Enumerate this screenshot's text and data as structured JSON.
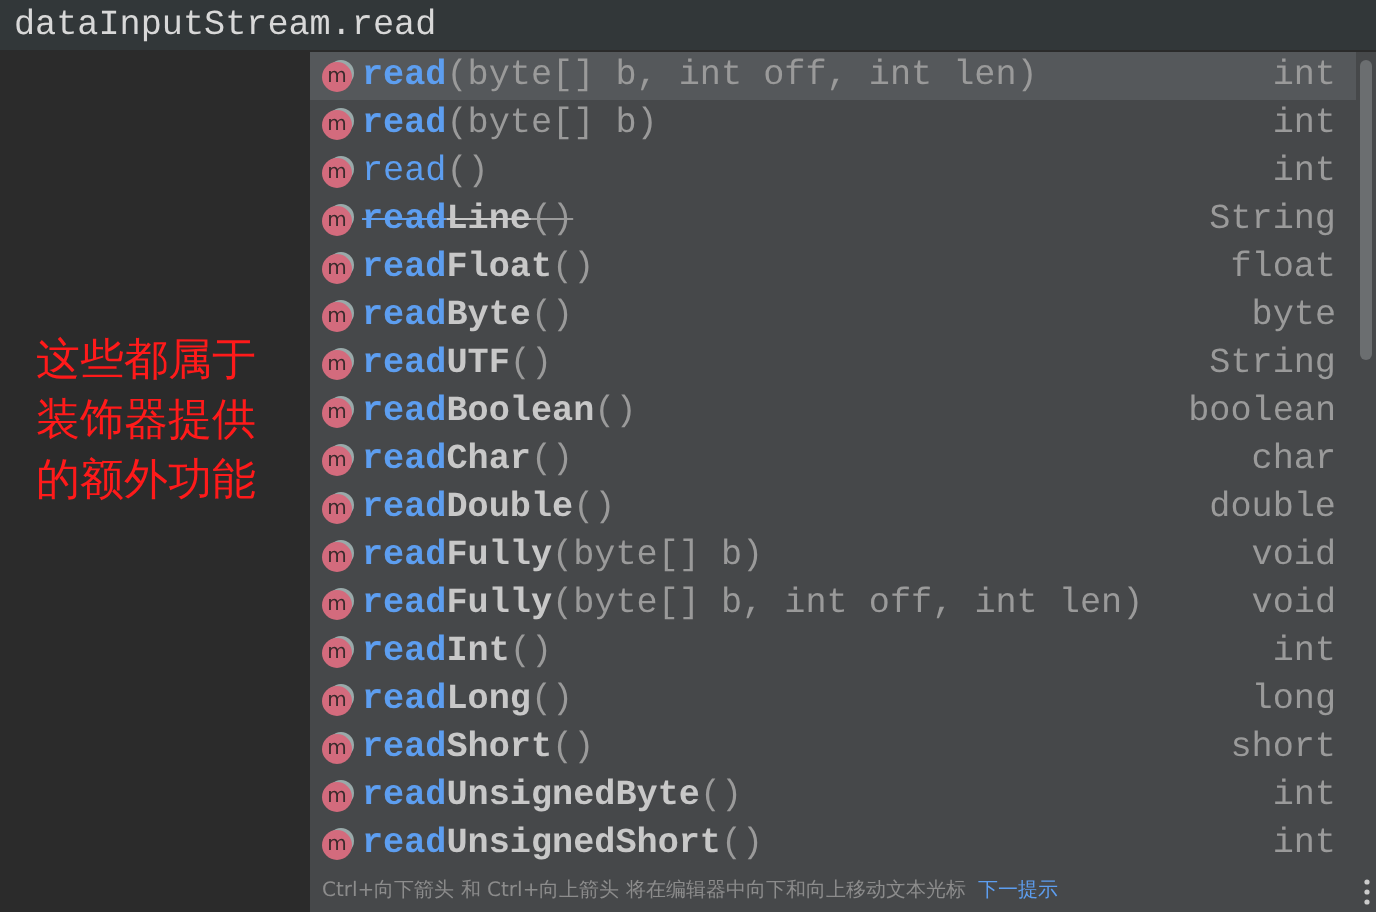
{
  "editor": {
    "code_line": "dataInputStream.read"
  },
  "annotation": {
    "lines": [
      "这些都属于",
      "装饰器提供",
      "的额外功能"
    ]
  },
  "completion_popup": {
    "items": [
      {
        "icon": "m",
        "match": "read",
        "params": "(byte[] b, int off, int len)",
        "type": "int",
        "selected": true,
        "bold": true,
        "deprecated": false
      },
      {
        "icon": "m",
        "match": "read",
        "params": "(byte[] b)",
        "type": "int",
        "selected": false,
        "bold": true,
        "deprecated": false
      },
      {
        "icon": "m",
        "match": "read",
        "params": "()",
        "type": "int",
        "selected": false,
        "bold": false,
        "deprecated": false
      },
      {
        "icon": "m",
        "match": "read",
        "rest": "Line",
        "params": "()",
        "type": "String",
        "selected": false,
        "bold": true,
        "deprecated": true
      },
      {
        "icon": "m",
        "match": "read",
        "rest": "Float",
        "params": "()",
        "type": "float",
        "selected": false,
        "bold": true,
        "deprecated": false
      },
      {
        "icon": "m",
        "match": "read",
        "rest": "Byte",
        "params": "()",
        "type": "byte",
        "selected": false,
        "bold": true,
        "deprecated": false
      },
      {
        "icon": "m",
        "match": "read",
        "rest": "UTF",
        "params": "()",
        "type": "String",
        "selected": false,
        "bold": true,
        "deprecated": false
      },
      {
        "icon": "m",
        "match": "read",
        "rest": "Boolean",
        "params": "()",
        "type": "boolean",
        "selected": false,
        "bold": true,
        "deprecated": false
      },
      {
        "icon": "m",
        "match": "read",
        "rest": "Char",
        "params": "()",
        "type": "char",
        "selected": false,
        "bold": true,
        "deprecated": false
      },
      {
        "icon": "m",
        "match": "read",
        "rest": "Double",
        "params": "()",
        "type": "double",
        "selected": false,
        "bold": true,
        "deprecated": false
      },
      {
        "icon": "m",
        "match": "read",
        "rest": "Fully",
        "params": "(byte[] b)",
        "type": "void",
        "selected": false,
        "bold": true,
        "deprecated": false
      },
      {
        "icon": "m",
        "match": "read",
        "rest": "Fully",
        "params": "(byte[] b, int off, int len)",
        "type": "void",
        "selected": false,
        "bold": true,
        "deprecated": false
      },
      {
        "icon": "m",
        "match": "read",
        "rest": "Int",
        "params": "()",
        "type": "int",
        "selected": false,
        "bold": true,
        "deprecated": false
      },
      {
        "icon": "m",
        "match": "read",
        "rest": "Long",
        "params": "()",
        "type": "long",
        "selected": false,
        "bold": true,
        "deprecated": false
      },
      {
        "icon": "m",
        "match": "read",
        "rest": "Short",
        "params": "()",
        "type": "short",
        "selected": false,
        "bold": true,
        "deprecated": false
      },
      {
        "icon": "m",
        "match": "read",
        "rest": "UnsignedByte",
        "params": "()",
        "type": "int",
        "selected": false,
        "bold": true,
        "deprecated": false
      },
      {
        "icon": "m",
        "match": "read",
        "rest": "UnsignedShort",
        "params": "()",
        "type": "int",
        "selected": false,
        "bold": true,
        "deprecated": false
      }
    ],
    "hint": "Ctrl+向下箭头 和 Ctrl+向上箭头 将在编辑器中向下和向上移动文本光标",
    "hint_link": "下一提示"
  }
}
